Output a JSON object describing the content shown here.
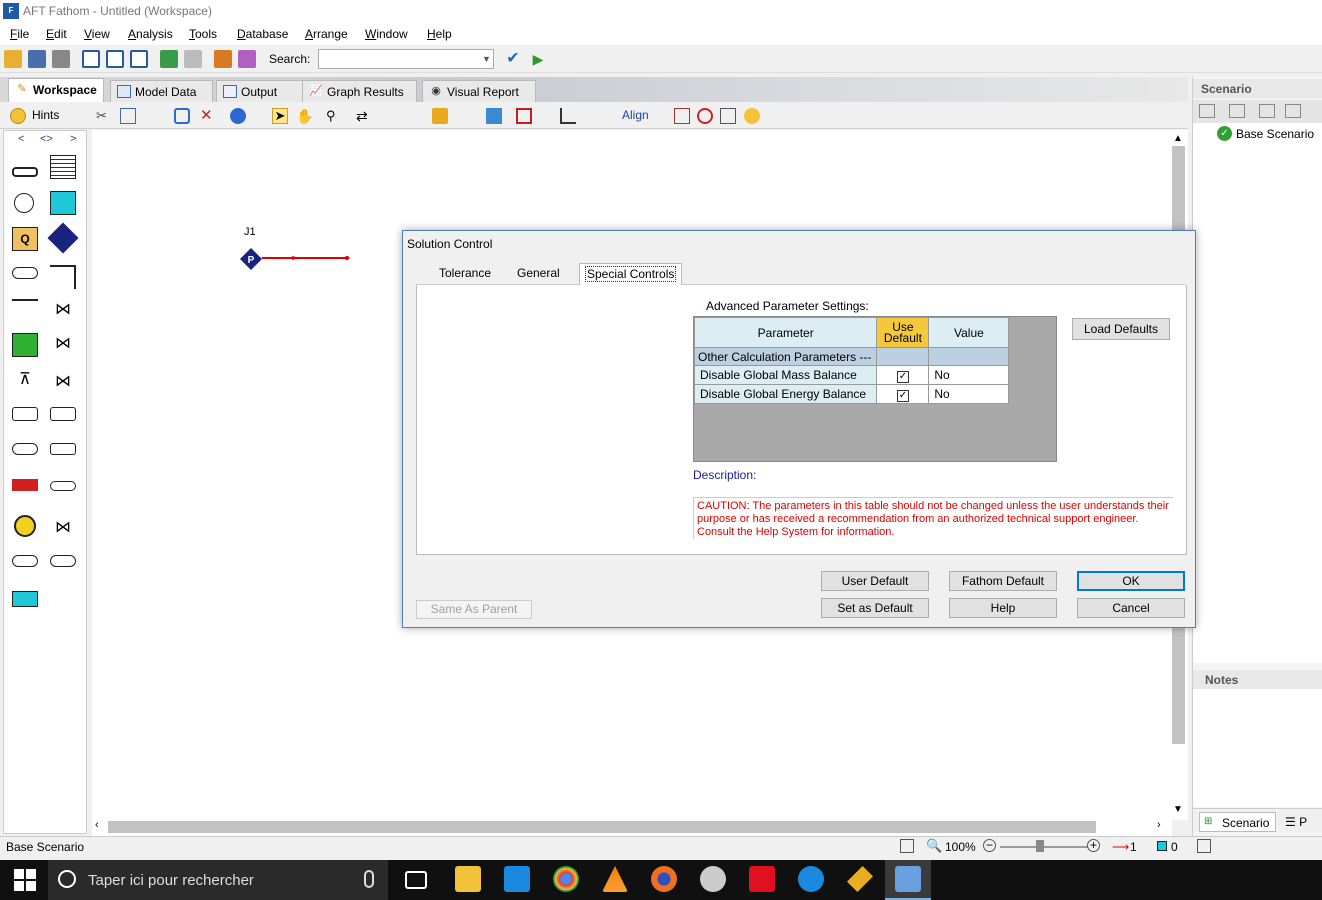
{
  "window": {
    "title": "AFT Fathom - Untitled (Workspace)",
    "logo_text": "F"
  },
  "menu": [
    "File",
    "Edit",
    "View",
    "Analysis",
    "Tools",
    "Database",
    "Arrange",
    "Window",
    "Help"
  ],
  "toolbar": {
    "search_label": "Search:",
    "search_value": ""
  },
  "workspace_tabs": [
    "Workspace",
    "Model Data",
    "Output",
    "Graph Results",
    "Visual Report"
  ],
  "workspace_toolbar": {
    "hints": "Hints",
    "align": "Align"
  },
  "palette": {
    "nav": [
      "<",
      "<>",
      ">"
    ]
  },
  "canvas": {
    "junction_label": "J1",
    "junction_letter": "P"
  },
  "right_panel": {
    "scenario_title": "Scenario",
    "base_scenario": "Base Scenario",
    "notes_title": "Notes",
    "tabs": [
      "Scenario",
      "P"
    ]
  },
  "status": {
    "scenario": "Base Scenario",
    "zoom": "100%",
    "pipes": "1",
    "junctions": "0"
  },
  "dialog": {
    "title": "Solution Control",
    "tabs": [
      "Tolerance",
      "General",
      "Special Controls"
    ],
    "active_tab": "Special Controls",
    "adv_label": "Advanced Parameter Settings:",
    "table": {
      "headers": {
        "parameter": "Parameter",
        "use_default_1": "Use",
        "use_default_2": "Default",
        "value": "Value"
      },
      "group": "Other Calculation Parameters ---",
      "rows": [
        {
          "parameter": "Disable Global Mass Balance",
          "use_default": true,
          "value": "No"
        },
        {
          "parameter": "Disable Global Energy Balance",
          "use_default": true,
          "value": "No"
        }
      ]
    },
    "load_defaults": "Load Defaults",
    "description_label": "Description:",
    "caution": "CAUTION: The parameters in this table should not be changed unless the user understands their purpose or has received a recommendation from an authorized technical support engineer. Consult the Help System for information.",
    "buttons": {
      "same_as_parent": "Same As Parent",
      "user_default": "User Default",
      "fathom_default": "Fathom Default",
      "ok": "OK",
      "set_as_default": "Set as Default",
      "help": "Help",
      "cancel": "Cancel"
    }
  },
  "taskbar": {
    "search_placeholder": "Taper ici pour rechercher"
  },
  "colors": {
    "accent": "#0078d7",
    "caution": "#e00000",
    "use_default_header": "#f3c83a",
    "param_cell": "#dceef3",
    "pipe": "#e00000",
    "junction": "#1a237e"
  }
}
